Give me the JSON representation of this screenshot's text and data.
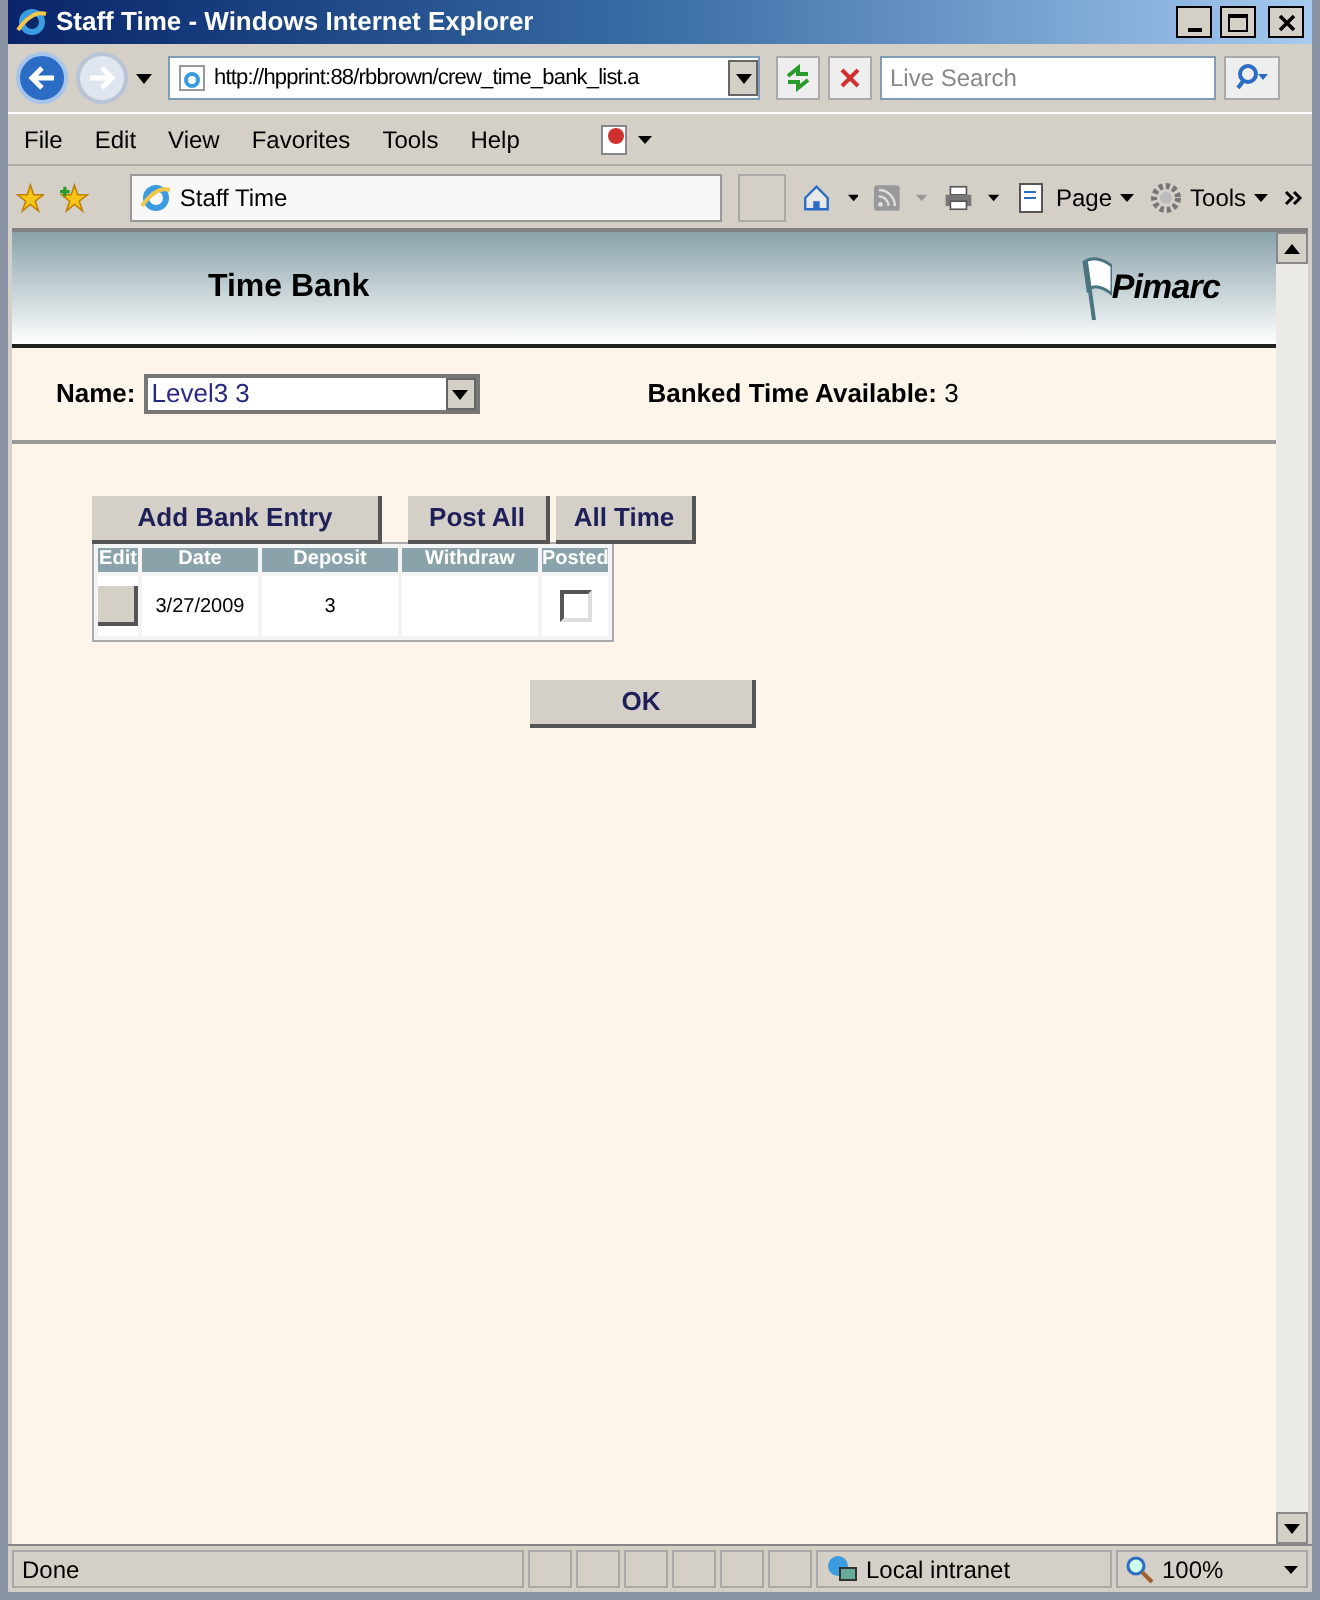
{
  "window": {
    "title": "Staff Time - Windows Internet Explorer"
  },
  "address_bar": {
    "url": "http://hpprint:88/rbbrown/crew_time_bank_list.a"
  },
  "search": {
    "placeholder": "Live Search"
  },
  "menu": [
    "File",
    "Edit",
    "View",
    "Favorites",
    "Tools",
    "Help"
  ],
  "tabs": [
    {
      "label": "Staff Time",
      "selected": true
    }
  ],
  "command_bar": [
    "Page",
    "Tools"
  ],
  "page": {
    "title": "Time Bank",
    "logo": "Pimarc",
    "name_label": "Name:",
    "name_value": "Level3 3",
    "banked_label": "Banked Time Available:",
    "banked_value": "3",
    "buttons": [
      "Add Bank Entry",
      "Post All",
      "All Time"
    ],
    "table": {
      "columns": [
        "Edit",
        "Date",
        "Deposit",
        "Withdraw",
        "Posted"
      ],
      "rows": [
        {
          "date": "3/27/2009",
          "deposit": "3",
          "posted": false
        }
      ]
    },
    "ok_button": "OK"
  },
  "status_bar": {
    "text": "Done",
    "zone": "Local intranet",
    "zoom": "100%"
  }
}
